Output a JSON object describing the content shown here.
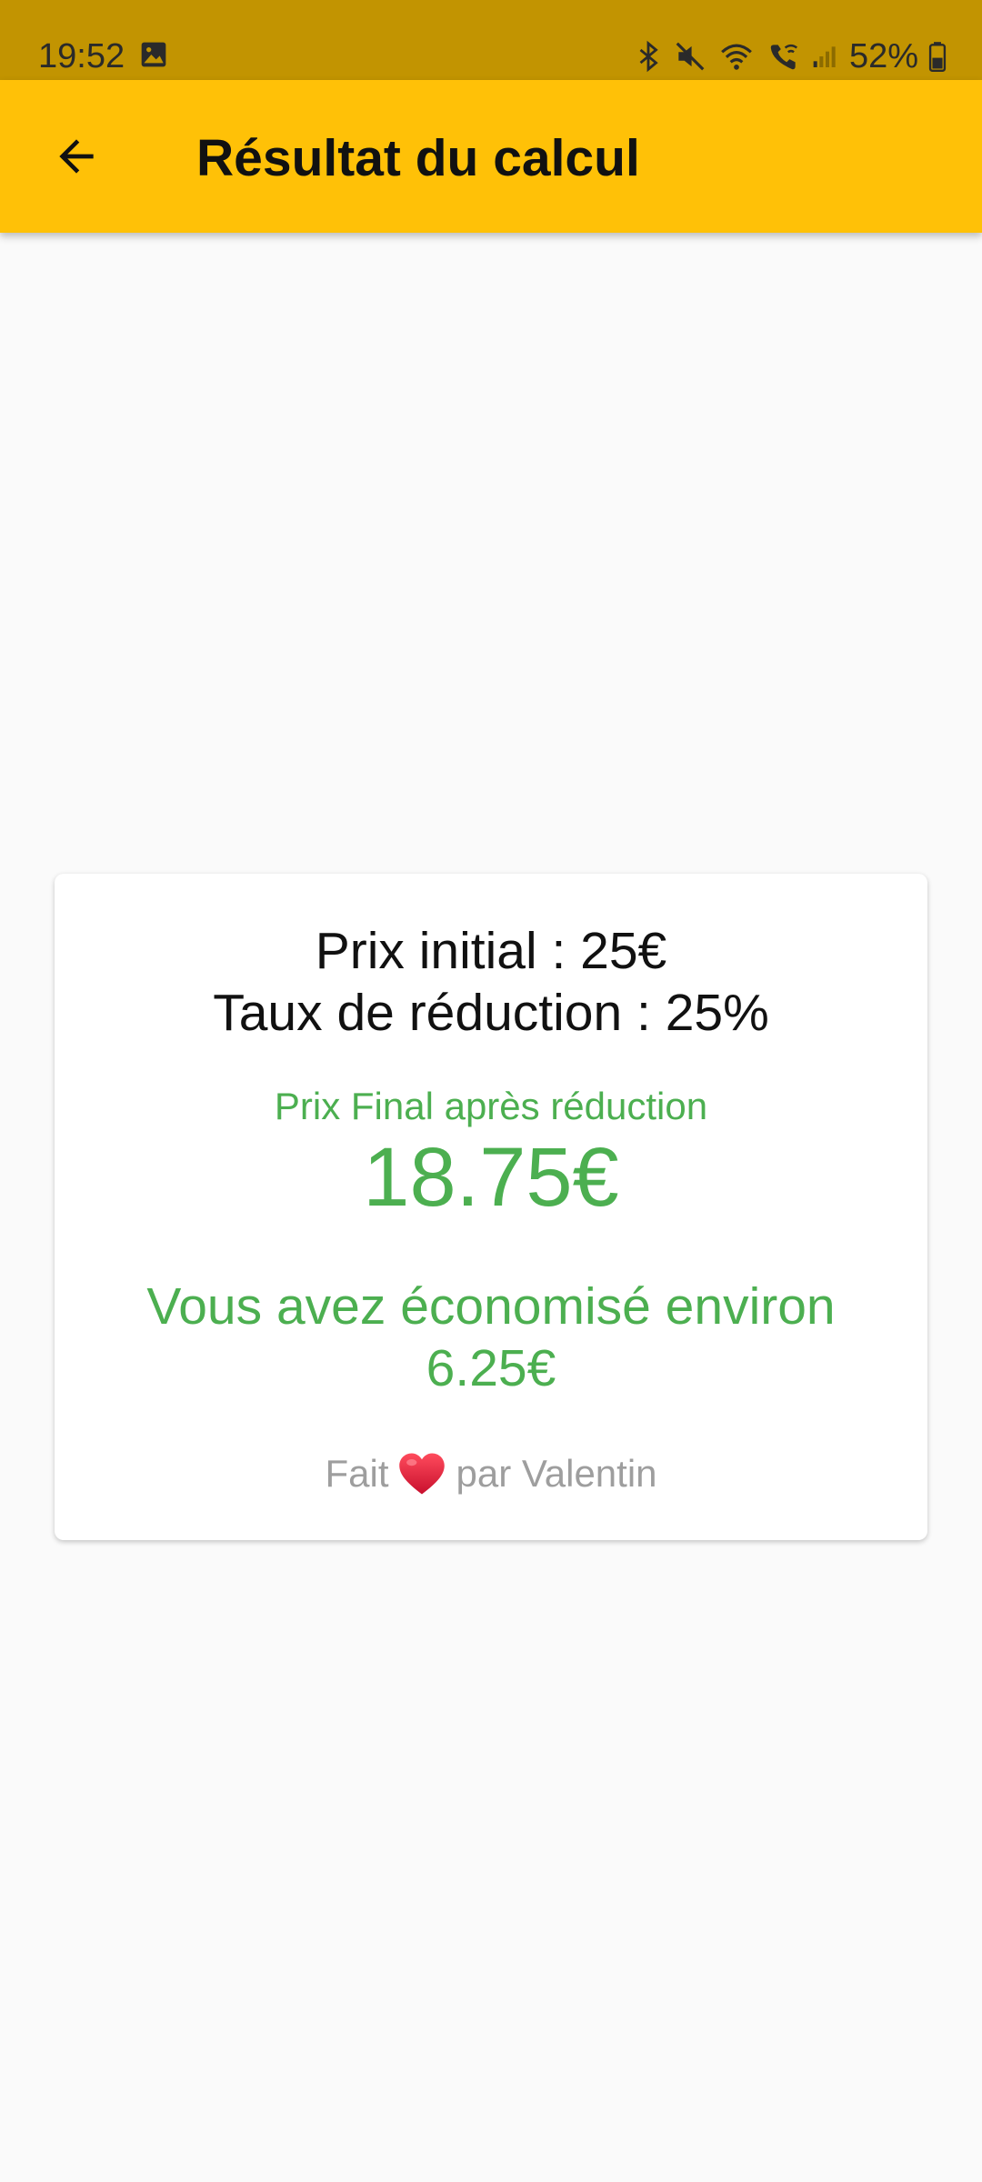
{
  "status_bar": {
    "time": "19:52",
    "battery": "52%",
    "icons": [
      "image-icon",
      "bluetooth-icon",
      "mute-icon",
      "wifi-icon",
      "wifi-calling-icon",
      "signal-icon",
      "battery-icon"
    ]
  },
  "app_bar": {
    "title": "Résultat du calcul",
    "back_icon": "arrow-back-icon",
    "color": "#ffc107"
  },
  "card": {
    "initial_price": "Prix initial : 25€",
    "discount_rate": "Taux de réduction : 25%",
    "final_label": "Prix Final après réduction",
    "final_price": "18.75€",
    "savings_text": "Vous avez économisé environ",
    "savings_amount": "6.25€",
    "credit_prefix": "Fait",
    "credit_icon": "heart-icon",
    "credit_suffix": "par Valentin",
    "accent_color": "#4caf50"
  }
}
